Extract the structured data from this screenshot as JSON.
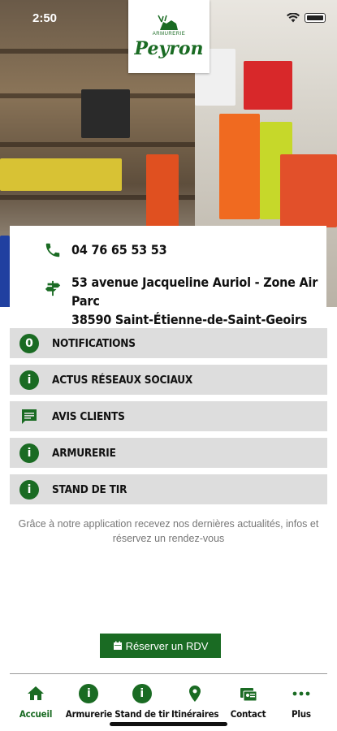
{
  "status_bar": {
    "time": "2:50"
  },
  "brand": {
    "logo_text": "Peyron",
    "logo_sub": "ARMURERIE"
  },
  "contact": {
    "phone": "04 76 65 53 53",
    "address_line1": "53 avenue Jacqueline Auriol - Zone Air Parc",
    "address_line2": "38590 Saint-Étienne-de-Saint-Geoirs"
  },
  "menu": [
    {
      "label": "NOTIFICATIONS",
      "icon": "notification-count-icon",
      "badge": "0"
    },
    {
      "label": "ACTUS RÉSEAUX SOCIAUX",
      "icon": "info-icon"
    },
    {
      "label": "AVIS CLIENTS",
      "icon": "comment-icon"
    },
    {
      "label": "ARMURERIE",
      "icon": "info-icon"
    },
    {
      "label": "STAND DE TIR",
      "icon": "info-icon"
    }
  ],
  "tagline": "Grâce à notre application recevez nos dernières actualités, infos et réservez un rendez-vous",
  "rdv_button": {
    "label": "Réserver un RDV",
    "icon": "calendar-icon"
  },
  "nav": [
    {
      "label": "Accueil",
      "icon": "home-icon",
      "active": true
    },
    {
      "label": "Armurerie",
      "icon": "info-icon"
    },
    {
      "label": "Stand de tir",
      "icon": "info-icon"
    },
    {
      "label": "Itinéraires",
      "icon": "map-pin-icon"
    },
    {
      "label": "Contact",
      "icon": "contact-card-icon"
    },
    {
      "label": "Plus",
      "icon": "more-icon"
    }
  ],
  "colors": {
    "brand_green": "#1a6b23",
    "row_bg": "#dddddd",
    "tagline": "#777777"
  }
}
